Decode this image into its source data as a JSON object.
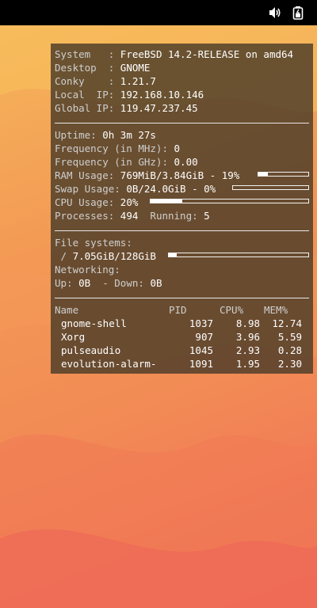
{
  "system": {
    "rows": [
      {
        "label": "System   : ",
        "value": "FreeBSD 14.2-RELEASE on amd64"
      },
      {
        "label": "Desktop  : ",
        "value": "GNOME"
      },
      {
        "label": "Conky    : ",
        "value": "1.21.7"
      },
      {
        "label": "Local  IP: ",
        "value": "192.168.10.146"
      },
      {
        "label": "Global IP: ",
        "value": "119.47.237.45"
      }
    ]
  },
  "stats": {
    "uptime_label": "Uptime: ",
    "uptime": "0h 3m 27s",
    "freq_mhz_label": "Frequency (in MHz): ",
    "freq_mhz": "0",
    "freq_ghz_label": "Frequency (in GHz): ",
    "freq_ghz": "0.00",
    "ram_label": "RAM Usage: ",
    "ram": "769MiB/3.84GiB - 19%",
    "ram_fraction": 0.19,
    "swap_label": "Swap Usage: ",
    "swap": "0B/24.0GiB - 0%",
    "swap_fraction": 0.0,
    "cpu_label": "CPU Usage: ",
    "cpu": "20%",
    "cpu_fraction": 0.2,
    "processes_label": "Processes: ",
    "processes": "494",
    "running_label": "  Running: ",
    "running": "5"
  },
  "fs": {
    "title": "File systems:",
    "root_prefix": " / ",
    "root": "7.05GiB/128GiB",
    "root_fraction": 0.055,
    "net_title": "Networking:",
    "up_label": "Up: ",
    "up": "0B",
    "down_label": "  - Down: ",
    "down": "0B"
  },
  "proc": {
    "headers": {
      "name": "Name",
      "pid": "PID",
      "cpu": "CPU%",
      "mem": "MEM%"
    },
    "rows": [
      {
        "name": "gnome-shell",
        "pid": "1037",
        "cpu": "8.98",
        "mem": "12.74"
      },
      {
        "name": "Xorg",
        "pid": "907",
        "cpu": "3.96",
        "mem": "5.59"
      },
      {
        "name": "pulseaudio",
        "pid": "1045",
        "cpu": "2.93",
        "mem": "0.28"
      },
      {
        "name": "evolution-alarm-",
        "pid": "1091",
        "cpu": "1.95",
        "mem": "2.30"
      }
    ]
  },
  "icons": {
    "volume": "speaker-icon",
    "battery": "battery-icon"
  },
  "colors": {
    "panel_bg": "#4b3c28",
    "text_label": "#cfcfcf",
    "text_value": "#ffffff"
  }
}
